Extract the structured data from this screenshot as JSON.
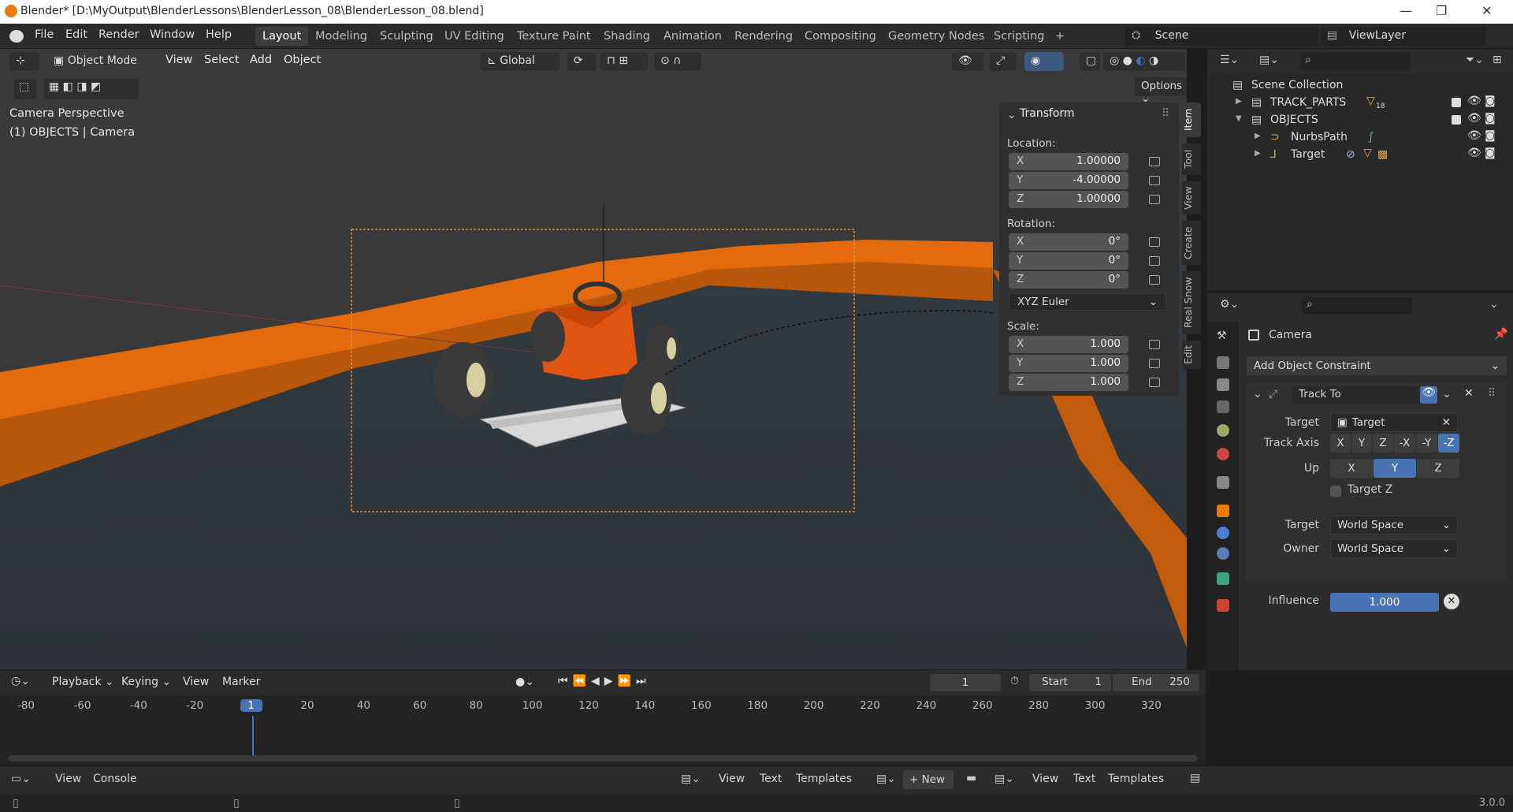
{
  "window": {
    "title": "Blender* [D:\\MyOutput\\BlenderLessons\\BlenderLesson_08\\BlenderLesson_08.blend]",
    "minimize": "—",
    "maximize": "❐",
    "close": "✕"
  },
  "menu": [
    "File",
    "Edit",
    "Render",
    "Window",
    "Help"
  ],
  "workspaces": [
    "Layout",
    "Modeling",
    "Sculpting",
    "UV Editing",
    "Texture Paint",
    "Shading",
    "Animation",
    "Rendering",
    "Compositing",
    "Geometry Nodes",
    "Scripting",
    "+"
  ],
  "scene": {
    "name": "Scene",
    "view_layer": "ViewLayer"
  },
  "viewport": {
    "mode": "Object Mode",
    "menus": [
      "View",
      "Select",
      "Add",
      "Object"
    ],
    "transform_orient": "Global",
    "options": "Options",
    "camera_label": "Camera Perspective",
    "object_label": "(1) OBJECTS | Camera"
  },
  "transform": {
    "title": "Transform",
    "location_label": "Location:",
    "location": {
      "x": "1.00000",
      "y": "-4.00000",
      "z": "1.00000"
    },
    "rotation_label": "Rotation:",
    "rotation": {
      "x": "0°",
      "y": "0°",
      "z": "0°"
    },
    "rotation_mode": "XYZ Euler",
    "scale_label": "Scale:",
    "scale": {
      "x": "1.000",
      "y": "1.000",
      "z": "1.000"
    },
    "axes": [
      "X",
      "Y",
      "Z"
    ]
  },
  "side_tabs": [
    "Item",
    "Tool",
    "View",
    "Create",
    "Real Snow",
    "Edit"
  ],
  "outliner": {
    "root": "Scene Collection",
    "items": [
      {
        "name": "TRACK_PARTS",
        "badge": "18"
      },
      {
        "name": "OBJECTS"
      },
      {
        "name": "NurbsPath"
      },
      {
        "name": "Target"
      }
    ]
  },
  "properties": {
    "object": "Camera",
    "add_constraint": "Add Object Constraint",
    "constraint_name": "Track To",
    "target_label": "Target",
    "target_value": "Target",
    "track_axis_label": "Track Axis",
    "track_axes": [
      "X",
      "Y",
      "Z",
      "-X",
      "-Y",
      "-Z"
    ],
    "up_label": "Up",
    "up_axes": [
      "X",
      "Y",
      "Z"
    ],
    "target_z": "Target Z",
    "target_space_label": "Target",
    "target_space": "World Space",
    "owner_space_label": "Owner",
    "owner_space": "World Space",
    "influence_label": "Influence",
    "influence": "1.000"
  },
  "timeline": {
    "menus": [
      "Playback",
      "Keying",
      "View",
      "Marker"
    ],
    "current_frame": "1",
    "start_label": "Start",
    "start": "1",
    "end_label": "End",
    "end": "250",
    "ticks": [
      "-80",
      "-60",
      "-40",
      "-20",
      "1",
      "20",
      "40",
      "60",
      "80",
      "100",
      "120",
      "140",
      "160",
      "180",
      "200",
      "220",
      "240",
      "260",
      "280",
      "300",
      "320"
    ]
  },
  "bottom": {
    "console_menus": [
      "View",
      "Console"
    ],
    "text_menus": [
      "View",
      "Text",
      "Templates"
    ],
    "new": "New",
    "text_menus2": [
      "View",
      "Text",
      "Templates"
    ]
  },
  "status": {
    "version": "3.0.0"
  }
}
